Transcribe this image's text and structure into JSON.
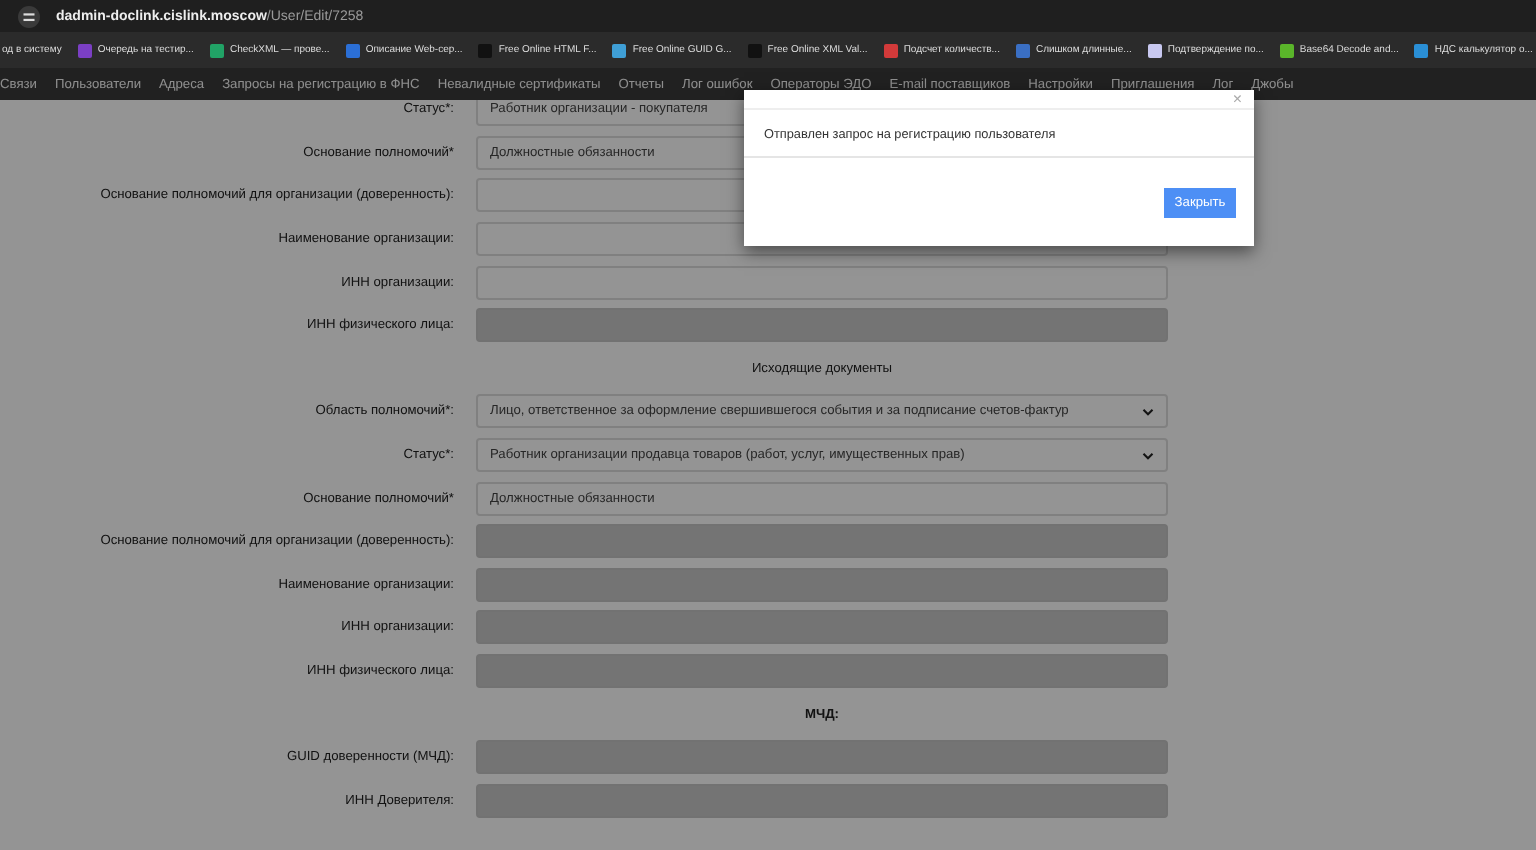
{
  "browser": {
    "url_host": "dadmin-doclink.cislink.moscow",
    "url_path": "/User/Edit/7258"
  },
  "bookmarks": [
    {
      "label": "од в систему"
    },
    {
      "label": "Очередь на тестир...",
      "color": "#7b3fc4"
    },
    {
      "label": "CheckXML — прове...",
      "color": "#21a366"
    },
    {
      "label": "Описание Web-сер...",
      "color": "#2b6fd6"
    },
    {
      "label": "Free Online HTML F...",
      "color": "#111111"
    },
    {
      "label": "Free Online GUID G...",
      "color": "#3f9fd6"
    },
    {
      "label": "Free Online XML Val...",
      "color": "#111111"
    },
    {
      "label": "Подсчет количеств...",
      "color": "#d23a3a"
    },
    {
      "label": "Слишком длинные...",
      "color": "#3a6fc4"
    },
    {
      "label": "Подтверждение по...",
      "color": "#c8c8f0"
    },
    {
      "label": "Base64 Decode and...",
      "color": "#5ab52a"
    },
    {
      "label": "НДС калькулятор о...",
      "color": "#2a8fd6"
    }
  ],
  "nav": [
    "Связи",
    "Пользователи",
    "Адреса",
    "Запросы на регистрацию в ФНС",
    "Невалидные сертификаты",
    "Отчеты",
    "Лог ошибок",
    "Операторы ЭДО",
    "E-mail поставщиков",
    "Настройки",
    "Приглашения",
    "Лог",
    "Джобы"
  ],
  "form": [
    {
      "kind": "select_plain",
      "label": "Статус*:",
      "value": "Работник организации - покупателя",
      "disabled": false
    },
    {
      "kind": "input",
      "label": "Основание полномочий*",
      "value": "Должностные обязанности",
      "disabled": false
    },
    {
      "kind": "input",
      "label": "Основание полномочий для организации (доверенность):",
      "disabled": false
    },
    {
      "kind": "input",
      "label": "Наименование организации:",
      "disabled": false
    },
    {
      "kind": "input",
      "label": "ИНН организации:",
      "disabled": false
    },
    {
      "kind": "input",
      "label": "ИНН физического лица:",
      "disabled": true
    },
    {
      "kind": "heading",
      "label": "Исходящие документы",
      "bold": false
    },
    {
      "kind": "select",
      "label": "Область полномочий*:",
      "value": "Лицо, ответственное за оформление свершившегося события и за подписание счетов-фактур",
      "disabled": false
    },
    {
      "kind": "select",
      "label": "Статус*:",
      "value": "Работник организации продавца товаров (работ, услуг, имущественных прав)",
      "disabled": false
    },
    {
      "kind": "input",
      "label": "Основание полномочий*",
      "value": "Должностные обязанности",
      "disabled": false
    },
    {
      "kind": "input",
      "label": "Основание полномочий для организации (доверенность):",
      "disabled": true
    },
    {
      "kind": "input",
      "label": "Наименование организации:",
      "disabled": true
    },
    {
      "kind": "input",
      "label": "ИНН организации:",
      "disabled": true
    },
    {
      "kind": "input",
      "label": "ИНН физического лица:",
      "disabled": true
    },
    {
      "kind": "heading",
      "label": "МЧД:",
      "bold": true
    },
    {
      "kind": "input",
      "label": "GUID доверенности (МЧД):",
      "disabled": true
    },
    {
      "kind": "input",
      "label": "ИНН Доверителя:",
      "disabled": true
    }
  ],
  "dialog": {
    "close": "×",
    "message": "Отправлен запрос на регистрацию пользователя",
    "button": "Закрыть"
  }
}
